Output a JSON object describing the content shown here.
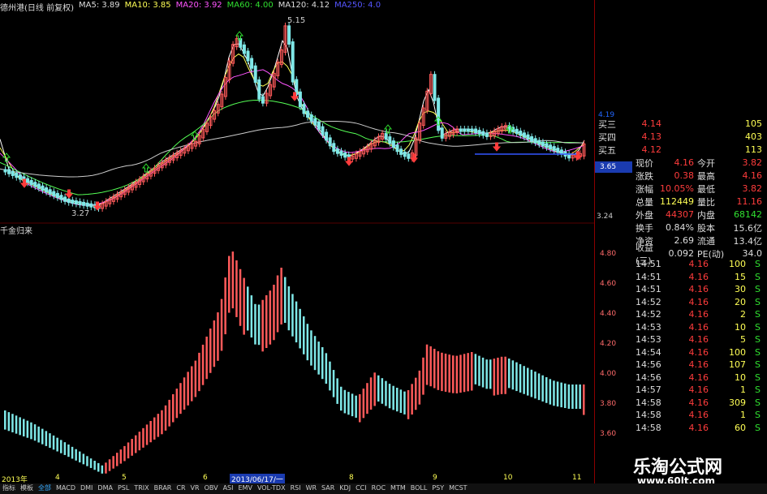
{
  "header": {
    "title": "德州港(日线 前复权)",
    "ma5": "MA5: 3.89",
    "ma10": "MA10: 3.85",
    "ma20": "MA20: 3.92",
    "ma60": "MA60: 4.00",
    "ma120": "MA120: 4.12",
    "ma250": "MA250: 4.0"
  },
  "main_chart": {
    "high_label": "5.15",
    "low_label": "3.27",
    "price_marker": "3.65",
    "bottom_price": "3.24",
    "top_price": "4.19"
  },
  "indicator": {
    "name": "千金归来",
    "ticks": [
      "4.80",
      "4.60",
      "4.40",
      "4.20",
      "4.00",
      "3.80",
      "3.60"
    ]
  },
  "x_axis": {
    "labels": [
      "2013年",
      "4",
      "5",
      "6",
      "2013/06/17/一",
      "8",
      "9",
      "10",
      "11"
    ]
  },
  "quote": {
    "bids": [
      {
        "label": "买三",
        "price": "4.14",
        "vol": "105"
      },
      {
        "label": "买四",
        "price": "4.13",
        "vol": "403"
      },
      {
        "label": "买五",
        "price": "4.12",
        "vol": "113"
      }
    ],
    "stats": [
      {
        "l": "现价",
        "v": "4.16",
        "l2": "今开",
        "v2": "3.82"
      },
      {
        "l": "涨跌",
        "v": "0.38",
        "l2": "最高",
        "v2": "4.16"
      },
      {
        "l": "涨幅",
        "v": "10.05%",
        "l2": "最低",
        "v2": "3.82"
      },
      {
        "l": "总量",
        "v": "112449",
        "l2": "量比",
        "v2": "11.16"
      },
      {
        "l": "外盘",
        "v": "44307",
        "l2": "内盘",
        "v2": "68142"
      },
      {
        "l": "换手",
        "v": "0.84%",
        "l2": "股本",
        "v2": "15.6亿"
      },
      {
        "l": "净资",
        "v": "2.69",
        "l2": "流通",
        "v2": "13.4亿"
      },
      {
        "l": "收益(三)",
        "v": "0.092",
        "l2": "PE(动)",
        "v2": "34.0"
      }
    ],
    "ticks": [
      {
        "t": "14:51",
        "p": "4.16",
        "v": "100",
        "s": "S"
      },
      {
        "t": "14:51",
        "p": "4.16",
        "v": "15",
        "s": "S"
      },
      {
        "t": "14:51",
        "p": "4.16",
        "v": "30",
        "s": "S"
      },
      {
        "t": "14:52",
        "p": "4.16",
        "v": "20",
        "s": "S"
      },
      {
        "t": "14:52",
        "p": "4.16",
        "v": "2",
        "s": "S"
      },
      {
        "t": "14:53",
        "p": "4.16",
        "v": "10",
        "s": "S"
      },
      {
        "t": "14:53",
        "p": "4.16",
        "v": "5",
        "s": "S"
      },
      {
        "t": "14:54",
        "p": "4.16",
        "v": "100",
        "s": "S"
      },
      {
        "t": "14:56",
        "p": "4.16",
        "v": "107",
        "s": "S"
      },
      {
        "t": "14:56",
        "p": "4.16",
        "v": "10",
        "s": "S"
      },
      {
        "t": "14:57",
        "p": "4.16",
        "v": "1",
        "s": "S"
      },
      {
        "t": "14:58",
        "p": "4.16",
        "v": "309",
        "s": "S"
      },
      {
        "t": "14:58",
        "p": "4.16",
        "v": "1",
        "s": "S"
      },
      {
        "t": "14:58",
        "p": "4.16",
        "v": "60",
        "s": "S"
      }
    ]
  },
  "bottom_tabs": [
    "指标",
    "模板",
    "全部",
    "MACD",
    "DMI",
    "DMA",
    "PSL",
    "TRIX",
    "BRAR",
    "CR",
    "VR",
    "OBV",
    "ASI",
    "EMV",
    "VOL-TDX",
    "RSI",
    "WR",
    "SAR",
    "KDJ",
    "CCI",
    "ROC",
    "MTM",
    "BOLL",
    "PSY",
    "MCST"
  ],
  "watermark": {
    "name": "乐淘公式网",
    "url": "www.60lt.com"
  },
  "colors": {
    "up": "#ff5a5a",
    "down": "#7fe8e8",
    "ma5": "#ffffff",
    "ma10": "#ffff55",
    "ma20": "#ff55ff",
    "ma60": "#55ff55",
    "ma120": "#cccccc"
  }
}
